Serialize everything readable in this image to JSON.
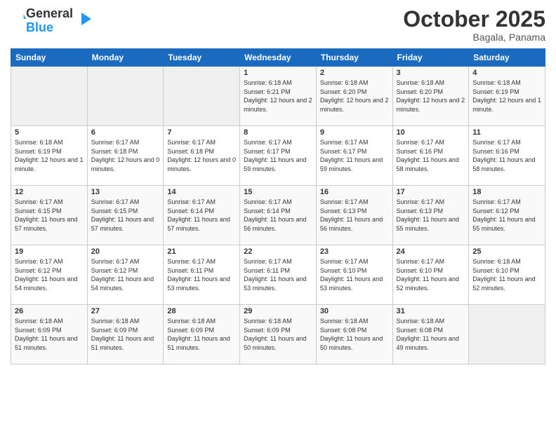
{
  "logo": {
    "general": "General",
    "blue": "Blue"
  },
  "header": {
    "month": "October 2025",
    "location": "Bagala, Panama"
  },
  "weekdays": [
    "Sunday",
    "Monday",
    "Tuesday",
    "Wednesday",
    "Thursday",
    "Friday",
    "Saturday"
  ],
  "weeks": [
    [
      {
        "day": "",
        "sunrise": "",
        "sunset": "",
        "daylight": "",
        "empty": true
      },
      {
        "day": "",
        "sunrise": "",
        "sunset": "",
        "daylight": "",
        "empty": true
      },
      {
        "day": "",
        "sunrise": "",
        "sunset": "",
        "daylight": "",
        "empty": true
      },
      {
        "day": "1",
        "sunrise": "Sunrise: 6:18 AM",
        "sunset": "Sunset: 6:21 PM",
        "daylight": "Daylight: 12 hours and 2 minutes.",
        "empty": false
      },
      {
        "day": "2",
        "sunrise": "Sunrise: 6:18 AM",
        "sunset": "Sunset: 6:20 PM",
        "daylight": "Daylight: 12 hours and 2 minutes.",
        "empty": false
      },
      {
        "day": "3",
        "sunrise": "Sunrise: 6:18 AM",
        "sunset": "Sunset: 6:20 PM",
        "daylight": "Daylight: 12 hours and 2 minutes.",
        "empty": false
      },
      {
        "day": "4",
        "sunrise": "Sunrise: 6:18 AM",
        "sunset": "Sunset: 6:19 PM",
        "daylight": "Daylight: 12 hours and 1 minute.",
        "empty": false
      }
    ],
    [
      {
        "day": "5",
        "sunrise": "Sunrise: 6:18 AM",
        "sunset": "Sunset: 6:19 PM",
        "daylight": "Daylight: 12 hours and 1 minute.",
        "empty": false
      },
      {
        "day": "6",
        "sunrise": "Sunrise: 6:17 AM",
        "sunset": "Sunset: 6:18 PM",
        "daylight": "Daylight: 12 hours and 0 minutes.",
        "empty": false
      },
      {
        "day": "7",
        "sunrise": "Sunrise: 6:17 AM",
        "sunset": "Sunset: 6:18 PM",
        "daylight": "Daylight: 12 hours and 0 minutes.",
        "empty": false
      },
      {
        "day": "8",
        "sunrise": "Sunrise: 6:17 AM",
        "sunset": "Sunset: 6:17 PM",
        "daylight": "Daylight: 11 hours and 59 minutes.",
        "empty": false
      },
      {
        "day": "9",
        "sunrise": "Sunrise: 6:17 AM",
        "sunset": "Sunset: 6:17 PM",
        "daylight": "Daylight: 11 hours and 59 minutes.",
        "empty": false
      },
      {
        "day": "10",
        "sunrise": "Sunrise: 6:17 AM",
        "sunset": "Sunset: 6:16 PM",
        "daylight": "Daylight: 11 hours and 58 minutes.",
        "empty": false
      },
      {
        "day": "11",
        "sunrise": "Sunrise: 6:17 AM",
        "sunset": "Sunset: 6:16 PM",
        "daylight": "Daylight: 11 hours and 58 minutes.",
        "empty": false
      }
    ],
    [
      {
        "day": "12",
        "sunrise": "Sunrise: 6:17 AM",
        "sunset": "Sunset: 6:15 PM",
        "daylight": "Daylight: 11 hours and 57 minutes.",
        "empty": false
      },
      {
        "day": "13",
        "sunrise": "Sunrise: 6:17 AM",
        "sunset": "Sunset: 6:15 PM",
        "daylight": "Daylight: 11 hours and 57 minutes.",
        "empty": false
      },
      {
        "day": "14",
        "sunrise": "Sunrise: 6:17 AM",
        "sunset": "Sunset: 6:14 PM",
        "daylight": "Daylight: 11 hours and 57 minutes.",
        "empty": false
      },
      {
        "day": "15",
        "sunrise": "Sunrise: 6:17 AM",
        "sunset": "Sunset: 6:14 PM",
        "daylight": "Daylight: 11 hours and 56 minutes.",
        "empty": false
      },
      {
        "day": "16",
        "sunrise": "Sunrise: 6:17 AM",
        "sunset": "Sunset: 6:13 PM",
        "daylight": "Daylight: 11 hours and 56 minutes.",
        "empty": false
      },
      {
        "day": "17",
        "sunrise": "Sunrise: 6:17 AM",
        "sunset": "Sunset: 6:13 PM",
        "daylight": "Daylight: 11 hours and 55 minutes.",
        "empty": false
      },
      {
        "day": "18",
        "sunrise": "Sunrise: 6:17 AM",
        "sunset": "Sunset: 6:12 PM",
        "daylight": "Daylight: 11 hours and 55 minutes.",
        "empty": false
      }
    ],
    [
      {
        "day": "19",
        "sunrise": "Sunrise: 6:17 AM",
        "sunset": "Sunset: 6:12 PM",
        "daylight": "Daylight: 11 hours and 54 minutes.",
        "empty": false
      },
      {
        "day": "20",
        "sunrise": "Sunrise: 6:17 AM",
        "sunset": "Sunset: 6:12 PM",
        "daylight": "Daylight: 11 hours and 54 minutes.",
        "empty": false
      },
      {
        "day": "21",
        "sunrise": "Sunrise: 6:17 AM",
        "sunset": "Sunset: 6:11 PM",
        "daylight": "Daylight: 11 hours and 53 minutes.",
        "empty": false
      },
      {
        "day": "22",
        "sunrise": "Sunrise: 6:17 AM",
        "sunset": "Sunset: 6:11 PM",
        "daylight": "Daylight: 11 hours and 53 minutes.",
        "empty": false
      },
      {
        "day": "23",
        "sunrise": "Sunrise: 6:17 AM",
        "sunset": "Sunset: 6:10 PM",
        "daylight": "Daylight: 11 hours and 53 minutes.",
        "empty": false
      },
      {
        "day": "24",
        "sunrise": "Sunrise: 6:17 AM",
        "sunset": "Sunset: 6:10 PM",
        "daylight": "Daylight: 11 hours and 52 minutes.",
        "empty": false
      },
      {
        "day": "25",
        "sunrise": "Sunrise: 6:18 AM",
        "sunset": "Sunset: 6:10 PM",
        "daylight": "Daylight: 11 hours and 52 minutes.",
        "empty": false
      }
    ],
    [
      {
        "day": "26",
        "sunrise": "Sunrise: 6:18 AM",
        "sunset": "Sunset: 6:09 PM",
        "daylight": "Daylight: 11 hours and 51 minutes.",
        "empty": false
      },
      {
        "day": "27",
        "sunrise": "Sunrise: 6:18 AM",
        "sunset": "Sunset: 6:09 PM",
        "daylight": "Daylight: 11 hours and 51 minutes.",
        "empty": false
      },
      {
        "day": "28",
        "sunrise": "Sunrise: 6:18 AM",
        "sunset": "Sunset: 6:09 PM",
        "daylight": "Daylight: 11 hours and 51 minutes.",
        "empty": false
      },
      {
        "day": "29",
        "sunrise": "Sunrise: 6:18 AM",
        "sunset": "Sunset: 6:09 PM",
        "daylight": "Daylight: 11 hours and 50 minutes.",
        "empty": false
      },
      {
        "day": "30",
        "sunrise": "Sunrise: 6:18 AM",
        "sunset": "Sunset: 6:08 PM",
        "daylight": "Daylight: 11 hours and 50 minutes.",
        "empty": false
      },
      {
        "day": "31",
        "sunrise": "Sunrise: 6:18 AM",
        "sunset": "Sunset: 6:08 PM",
        "daylight": "Daylight: 11 hours and 49 minutes.",
        "empty": false
      },
      {
        "day": "",
        "sunrise": "",
        "sunset": "",
        "daylight": "",
        "empty": true
      }
    ]
  ]
}
